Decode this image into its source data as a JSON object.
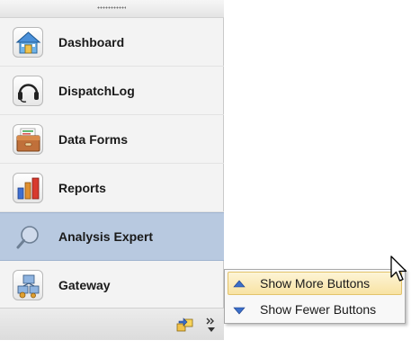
{
  "nav": {
    "items": [
      {
        "label": "Dashboard",
        "icon": "house-icon"
      },
      {
        "label": "DispatchLog",
        "icon": "headset-icon"
      },
      {
        "label": "Data Forms",
        "icon": "file-drawer-icon"
      },
      {
        "label": "Reports",
        "icon": "bar-chart-icon"
      },
      {
        "label": "Analysis Expert",
        "icon": "magnifier-icon",
        "selected": true
      },
      {
        "label": "Gateway",
        "icon": "gateway-network-icon"
      }
    ]
  },
  "bottom_bar": {
    "icons": [
      "add-remove-buttons-icon",
      "configure-chevron-icon"
    ]
  },
  "context_menu": {
    "items": [
      {
        "label": "Show More Buttons",
        "icon": "arrow-up-icon",
        "highlighted": true
      },
      {
        "label": "Show Fewer Buttons",
        "icon": "arrow-down-icon"
      }
    ]
  },
  "colors": {
    "selected_bg": "#b8c9e0",
    "menu_hover_bg": "#f8e3a3",
    "arrow_blue": "#3b6fc9"
  }
}
